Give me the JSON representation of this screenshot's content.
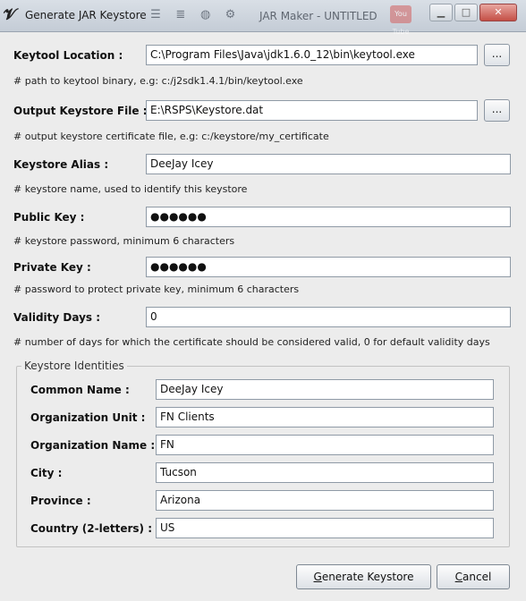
{
  "window": {
    "title": "Generate JAR Keystore",
    "background_app_title": "JAR Maker - UNTITLED",
    "background_badge": "You Tube"
  },
  "keytool": {
    "label": "Keytool Location :",
    "value": "C:\\Program Files\\Java\\jdk1.6.0_12\\bin\\keytool.exe",
    "hint": "# path to keytool binary, e.g: c:/j2sdk1.4.1/bin/keytool.exe",
    "browse_label": "..."
  },
  "output": {
    "label": "Output Keystore File :",
    "value": "E:\\RSPS\\Keystore.dat",
    "hint": "# output keystore certificate file, e.g: c:/keystore/my_certificate",
    "browse_label": "..."
  },
  "alias": {
    "label": "Keystore Alias :",
    "value": "DeeJay Icey",
    "hint": "# keystore name, used to identify this keystore"
  },
  "public_key": {
    "label": "Public Key :",
    "value": "●●●●●●",
    "hint": "# keystore password, minimum 6 characters"
  },
  "private_key": {
    "label": "Private Key :",
    "value": "●●●●●●",
    "hint": "# password to protect private key, minimum 6 characters"
  },
  "validity": {
    "label": "Validity Days :",
    "value": "0",
    "hint": "# number of days for which the certificate should be considered valid, 0 for default validity days"
  },
  "identities": {
    "title": "Keystore Identities",
    "common_name": {
      "label": "Common Name :",
      "value": "DeeJay Icey"
    },
    "org_unit": {
      "label": "Organization Unit :",
      "value": "FN Clients"
    },
    "org_name": {
      "label": "Organization Name :",
      "value": "FN"
    },
    "city": {
      "label": "City :",
      "value": "Tucson"
    },
    "province": {
      "label": "Province :",
      "value": "Arizona"
    },
    "country": {
      "label": "Country (2-letters) :",
      "value": "US"
    }
  },
  "actions": {
    "generate_mnemonic": "G",
    "generate_rest": "enerate Keystore",
    "cancel_mnemonic": "C",
    "cancel_rest": "ancel"
  },
  "icons": [
    "app-icon",
    "list-icon",
    "indent-icon",
    "globe-icon",
    "gear-icon",
    "minimize-icon",
    "maximize-icon",
    "close-icon"
  ]
}
